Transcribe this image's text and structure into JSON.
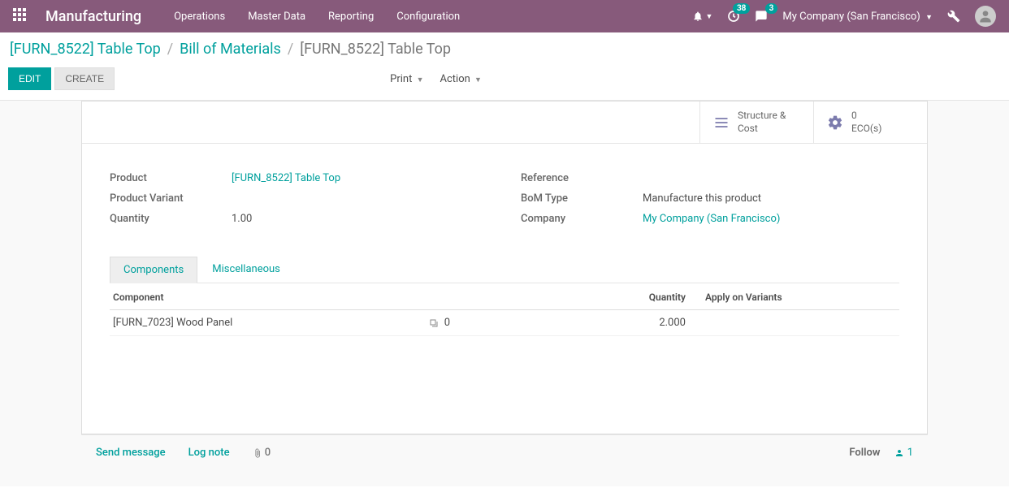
{
  "navbar": {
    "app_title": "Manufacturing",
    "menu": [
      "Operations",
      "Master Data",
      "Reporting",
      "Configuration"
    ],
    "clock_badge": "38",
    "chat_badge": "3",
    "company": "My Company (San Francisco)"
  },
  "breadcrumb": {
    "item1": "[FURN_8522] Table Top",
    "item2": "Bill of Materials",
    "current": "[FURN_8522] Table Top"
  },
  "ctrl": {
    "edit": "EDIT",
    "create": "CREATE",
    "print": "Print",
    "action": "Action"
  },
  "stat": {
    "structure_l1": "Structure &",
    "structure_l2": "Cost",
    "eco_count": "0",
    "eco_label": "ECO(s)"
  },
  "form": {
    "product_label": "Product",
    "product_value": "[FURN_8522] Table Top",
    "variant_label": "Product Variant",
    "variant_value": "",
    "quantity_label": "Quantity",
    "quantity_value": "1.00",
    "reference_label": "Reference",
    "reference_value": "",
    "bomtype_label": "BoM Type",
    "bomtype_value": "Manufacture this product",
    "company_label": "Company",
    "company_value": "My Company (San Francisco)"
  },
  "tabs": {
    "components": "Components",
    "misc": "Miscellaneous"
  },
  "table": {
    "h_component": "Component",
    "h_qty": "Quantity",
    "h_apply": "Apply on Variants",
    "rows": [
      {
        "component": "[FURN_7023] Wood Panel",
        "forecast": "0",
        "qty": "2.000",
        "apply": ""
      }
    ]
  },
  "chatter": {
    "send": "Send message",
    "log": "Log note",
    "attach_count": "0",
    "follow": "Follow",
    "followers": "1"
  }
}
